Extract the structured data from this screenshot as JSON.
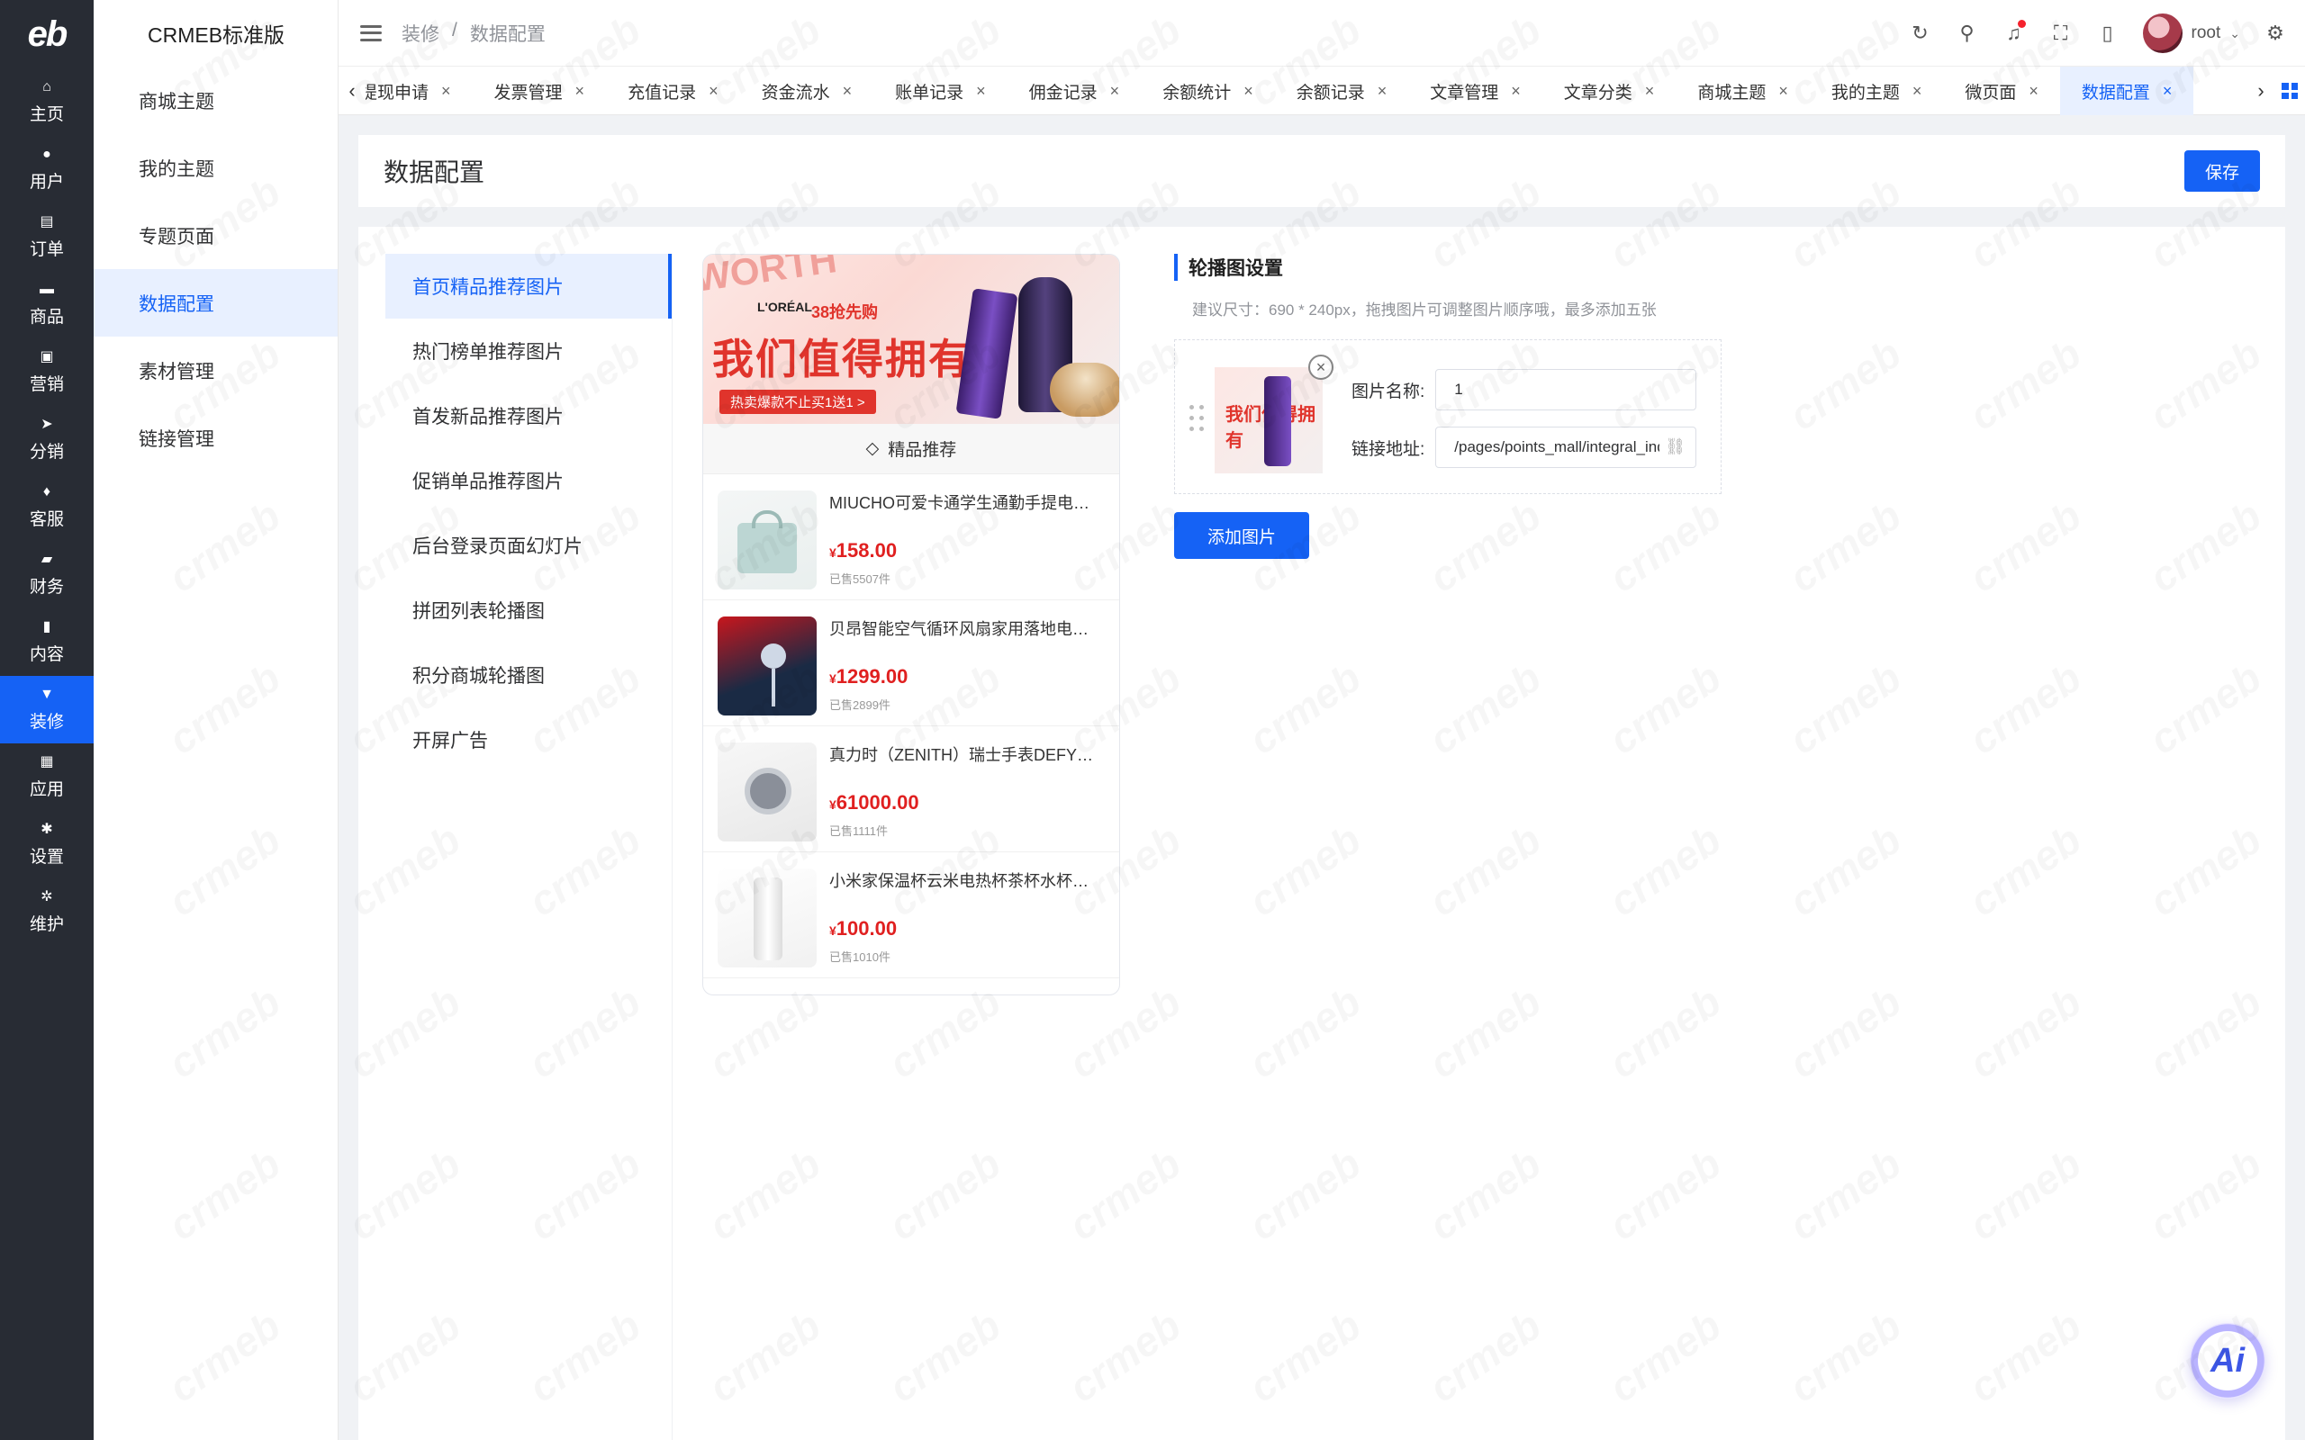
{
  "rail": {
    "logo": "eb",
    "items": [
      {
        "label": "主页",
        "icon": "home-icon",
        "glyph": "⌂"
      },
      {
        "label": "用户",
        "icon": "user-icon",
        "glyph": "●"
      },
      {
        "label": "订单",
        "icon": "order-icon",
        "glyph": "▤"
      },
      {
        "label": "商品",
        "icon": "product-icon",
        "glyph": "▬"
      },
      {
        "label": "营销",
        "icon": "marketing-icon",
        "glyph": "▣"
      },
      {
        "label": "分销",
        "icon": "distribution-icon",
        "glyph": "➤"
      },
      {
        "label": "客服",
        "icon": "service-icon",
        "glyph": "♦"
      },
      {
        "label": "财务",
        "icon": "finance-icon",
        "glyph": "▰"
      },
      {
        "label": "内容",
        "icon": "content-icon",
        "glyph": "▮"
      },
      {
        "label": "装修",
        "icon": "decoration-icon",
        "glyph": "▼"
      },
      {
        "label": "应用",
        "icon": "apps-icon",
        "glyph": "▦"
      },
      {
        "label": "设置",
        "icon": "settings-icon",
        "glyph": "✱"
      },
      {
        "label": "维护",
        "icon": "maintenance-icon",
        "glyph": "✲"
      }
    ]
  },
  "sidebar": {
    "brand": "CRMEB标准版",
    "items": [
      "商城主题",
      "我的主题",
      "专题页面",
      "数据配置",
      "素材管理",
      "链接管理"
    ]
  },
  "header": {
    "breadcrumb": [
      "装修",
      "/",
      "数据配置"
    ],
    "username": "root"
  },
  "tabs": [
    "提现申请",
    "发票管理",
    "充值记录",
    "资金流水",
    "账单记录",
    "佣金记录",
    "余额统计",
    "余额记录",
    "文章管理",
    "文章分类",
    "商城主题",
    "我的主题",
    "微页面",
    "数据配置"
  ],
  "page": {
    "title": "数据配置",
    "save_label": "保存"
  },
  "menu": [
    "首页精品推荐图片",
    "热门榜单推荐图片",
    "首发新品推荐图片",
    "促销单品推荐图片",
    "后台登录页面幻灯片",
    "拼团列表轮播图",
    "积分商城轮播图",
    "开屏广告"
  ],
  "preview": {
    "banner": {
      "worth": "WORTH",
      "brand": "L'ORÉAL",
      "tag": "38抢先购",
      "headline": "我们值得拥有",
      "pill": "热卖爆款不止买1送1 >"
    },
    "section_title": "精品推荐",
    "currency": "¥",
    "products": [
      {
        "name": "MIUCHO可爱卡通学生通勤手提电脑包",
        "price": "158.00",
        "sold": "已售5507件"
      },
      {
        "name": "贝昂智能空气循环风扇家用落地电风扇",
        "price": "1299.00",
        "sold": "已售2899件"
      },
      {
        "name": "真力时（ZENITH）瑞士手表DEFY系列",
        "price": "61000.00",
        "sold": "已售1111件"
      },
      {
        "name": "小米家保温杯云米电热杯茶杯水杯便携",
        "price": "100.00",
        "sold": "已售1010件"
      }
    ]
  },
  "settings": {
    "title": "轮播图设置",
    "hint": "建议尺寸：690 * 240px，拖拽图片可调整图片顺序哦，最多添加五张",
    "name_label": "图片名称:",
    "name_value": "1",
    "link_label": "链接地址:",
    "link_value": "/pages/points_mall/integral_index",
    "add_label": "添加图片"
  },
  "ai_label": "Ai",
  "watermark": "crmeb",
  "colors": {
    "primary": "#1562f5",
    "rail": "#282c34",
    "price": "#e02020"
  }
}
